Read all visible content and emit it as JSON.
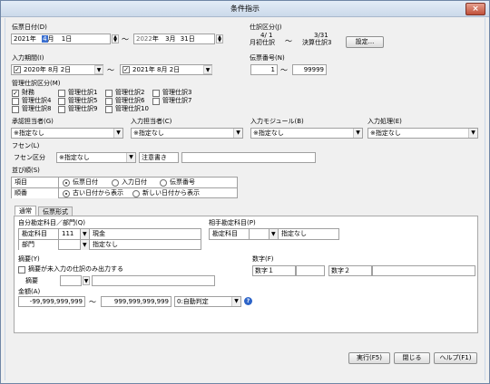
{
  "window": {
    "title": "条件指示",
    "close_glyph": "×"
  },
  "slip_date": {
    "label": "伝票日付(D)",
    "from": {
      "year": "2021",
      "year_suffix": "年",
      "month": "4",
      "month_suffix": "月",
      "day": "1",
      "day_suffix": "日"
    },
    "separator": "〜",
    "to": {
      "year": "2022",
      "year_suffix": "年",
      "month": "3",
      "month_suffix": "月",
      "day": "31",
      "day_suffix": "日"
    }
  },
  "journal_category": {
    "label": "仕訳区分(J)",
    "from_code": "4/ 1",
    "from_name": "月初仕訳",
    "separator": "〜",
    "to_code": "3/31",
    "to_name": "決算仕訳3",
    "settings_button": "設定..."
  },
  "input_period": {
    "label": "入力期間(I)",
    "from_checked": true,
    "from": "2020年  8月  2日",
    "separator": "〜",
    "to_checked": true,
    "to": "2021年  8月  2日"
  },
  "slip_number": {
    "label": "伝票番号(N)",
    "from": "1",
    "separator": "〜",
    "to": "99999"
  },
  "management_journal": {
    "label": "管理仕訳区分(M)",
    "options": [
      {
        "label": "財務",
        "checked": true
      },
      {
        "label": "管理仕訳1",
        "checked": false
      },
      {
        "label": "管理仕訳2",
        "checked": false
      },
      {
        "label": "管理仕訳3",
        "checked": false
      },
      {
        "label": "管理仕訳4",
        "checked": false
      },
      {
        "label": "管理仕訳5",
        "checked": false
      },
      {
        "label": "管理仕訳6",
        "checked": false
      },
      {
        "label": "管理仕訳7",
        "checked": false
      },
      {
        "label": "管理仕訳8",
        "checked": false
      },
      {
        "label": "管理仕訳9",
        "checked": false
      },
      {
        "label": "管理仕訳10",
        "checked": false
      }
    ]
  },
  "filters": {
    "approver": {
      "label": "承認担当者(G)",
      "value": "※指定なし"
    },
    "entry_person": {
      "label": "入力担当者(C)",
      "value": "※指定なし"
    },
    "input_module": {
      "label": "入力モジュール(B)",
      "value": "※指定なし"
    },
    "input_process": {
      "label": "入力処理(E)",
      "value": "※指定なし"
    }
  },
  "fusen": {
    "label": "フセン(L)",
    "category_label": "フセン区分",
    "category_value": "※指定なし",
    "note_label": "注意書き",
    "note_value": ""
  },
  "sort_order": {
    "label": "並び順(S)",
    "item_label": "項目",
    "item_options": [
      {
        "label": "伝票日付",
        "selected": true
      },
      {
        "label": "入力日付",
        "selected": false
      },
      {
        "label": "伝票番号",
        "selected": false
      }
    ],
    "order_label": "順番",
    "order_options": [
      {
        "label": "古い日付から表示",
        "selected": true
      },
      {
        "label": "新しい日付から表示",
        "selected": false
      }
    ]
  },
  "tabs": [
    {
      "label": "通常",
      "active": true
    },
    {
      "label": "伝票形式",
      "active": false
    }
  ],
  "own_account": {
    "label": "自分勘定科目／部門(Q)",
    "account_label": "勘定科目",
    "account_code": "111",
    "account_name": "現金",
    "dept_label": "部門",
    "dept_code": "",
    "dept_name": "指定なし"
  },
  "counter_account": {
    "label": "相手勘定科目(P)",
    "account_label": "勘定科目",
    "account_code": "",
    "account_name": "指定なし"
  },
  "summary": {
    "label": "摘要(Y)",
    "unentered_only_label": "摘要が未入力の仕訳のみ出力する",
    "unentered_only_checked": false,
    "summary_label": "摘要",
    "summary_code": "",
    "summary_text": ""
  },
  "numbers": {
    "label": "数字(F)",
    "num1_label": "数字１",
    "num1_value": "",
    "num2_label": "数字２",
    "num2_value": ""
  },
  "amount": {
    "label": "金額(A)",
    "from": "-99,999,999,999",
    "separator": "〜",
    "to": "999,999,999,999",
    "mode": "0:自動判定"
  },
  "buttons": {
    "execute": "実行(F5)",
    "close": "閉じる",
    "help": "ヘルプ(F1)"
  }
}
